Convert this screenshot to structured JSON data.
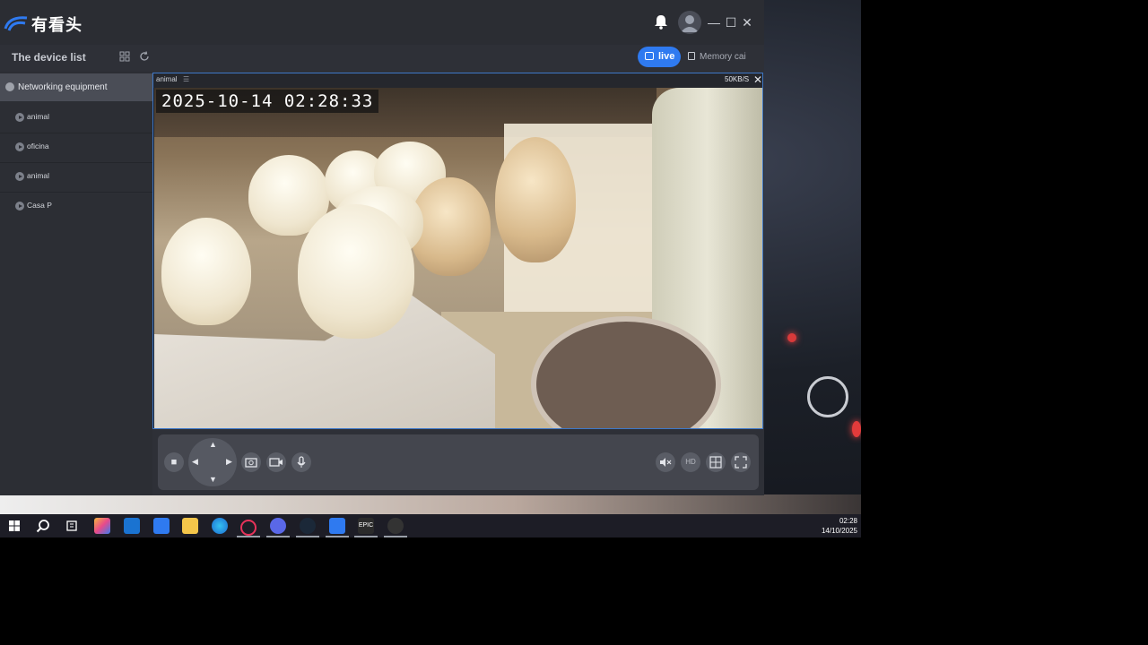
{
  "app": {
    "brand": "有看头",
    "window_controls": {
      "minimize": "—",
      "maximize": "☐",
      "close": "✕"
    }
  },
  "toolbar": {
    "device_list_title": "The device list",
    "live_label": "live",
    "memory_label": "Memory cai"
  },
  "sidebar": {
    "group_label": "Networking equipment",
    "devices": [
      {
        "name": "animal"
      },
      {
        "name": "oficina"
      },
      {
        "name": "animal"
      },
      {
        "name": "Casa P"
      }
    ]
  },
  "player": {
    "camera_name": "animal",
    "menu_glyph": "☰",
    "speed": "50KB/S",
    "close_glyph": "✕",
    "timestamp": "2025-10-14  02:28:33"
  },
  "controls": {
    "stop": "■",
    "ptz_up": "▲",
    "ptz_down": "▼",
    "ptz_left": "◀",
    "ptz_right": "▶",
    "snapshot_icon": "camera-snapshot-icon",
    "record_icon": "video-record-icon",
    "mic_icon": "microphone-icon",
    "mute_icon": "speaker-mute-icon",
    "hd_label": "HD",
    "grid_icon": "split-grid-icon",
    "fullscreen_icon": "fullscreen-icon"
  },
  "taskbar": {
    "time": "02:28",
    "date": "14/10/2025"
  },
  "colors": {
    "accent": "#2f7af0",
    "app_bg": "#2e3037",
    "selected_group": "#4a4d56"
  }
}
